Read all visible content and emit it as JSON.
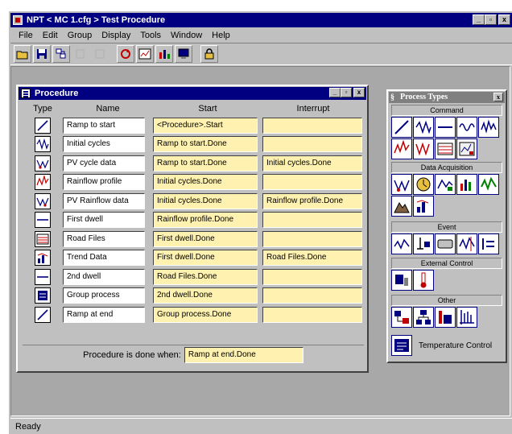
{
  "app": {
    "title": "NPT  < MC 1.cfg >   Test Procedure",
    "window_buttons": [
      "_",
      "▫",
      "x"
    ]
  },
  "menu": [
    "File",
    "Edit",
    "Group",
    "Display",
    "Tools",
    "Window",
    "Help"
  ],
  "toolbar": {
    "buttons": [
      "open-icon",
      "save-icon",
      "cut-icon",
      "copy-icon",
      "paste-icon",
      "refresh-icon",
      "chart-icon",
      "bars-icon",
      "monitor-icon",
      "lock-icon"
    ]
  },
  "procedure": {
    "title": "Procedure",
    "columns": {
      "type": "Type",
      "name": "Name",
      "start": "Start",
      "interrupt": "Interrupt"
    },
    "rows": [
      {
        "icon": "ramp-icon",
        "name": "Ramp to start",
        "start": "<Procedure>.Start",
        "interrupt": ""
      },
      {
        "icon": "cycle-icon",
        "name": "Initial cycles",
        "start": "Ramp to start.Done",
        "interrupt": ""
      },
      {
        "icon": "pv-cycle-icon",
        "name": "PV cycle data",
        "start": "Ramp to start.Done",
        "interrupt": "Initial cycles.Done"
      },
      {
        "icon": "rainflow-icon",
        "name": "Rainflow profile",
        "start": "Initial cycles.Done",
        "interrupt": ""
      },
      {
        "icon": "pv-rainflow-icon",
        "name": "PV Rainflow data",
        "start": "Initial cycles.Done",
        "interrupt": "Rainflow profile.Done"
      },
      {
        "icon": "dwell-icon",
        "name": "First dwell",
        "start": "Rainflow profile.Done",
        "interrupt": ""
      },
      {
        "icon": "road-files-icon",
        "name": "Road Files",
        "start": "First dwell.Done",
        "interrupt": ""
      },
      {
        "icon": "trend-icon",
        "name": "Trend Data",
        "start": "First dwell.Done",
        "interrupt": "Road Files.Done"
      },
      {
        "icon": "dwell-icon",
        "name": "2nd dwell",
        "start": "Road Files.Done",
        "interrupt": ""
      },
      {
        "icon": "group-process-icon",
        "name": "Group process",
        "start": "2nd dwell.Done",
        "interrupt": ""
      },
      {
        "icon": "ramp-icon",
        "name": "Ramp at end",
        "start": "Group process.Done",
        "interrupt": ""
      }
    ],
    "done_label": "Procedure is done when:",
    "done_value": "Ramp at end.Done"
  },
  "process_types": {
    "title": "Process Types",
    "sections": {
      "command": "Command",
      "data_acquisition": "Data Acquisition",
      "event": "Event",
      "external_control": "External Control",
      "other": "Other"
    },
    "temperature_control_label": "Temperature Control"
  },
  "status": {
    "text": "Ready"
  },
  "colors": {
    "titlebar": "#000080",
    "cell_yellow": "#fff2b0",
    "face": "#c0c0c0",
    "workspace": "#a8a8a8"
  }
}
